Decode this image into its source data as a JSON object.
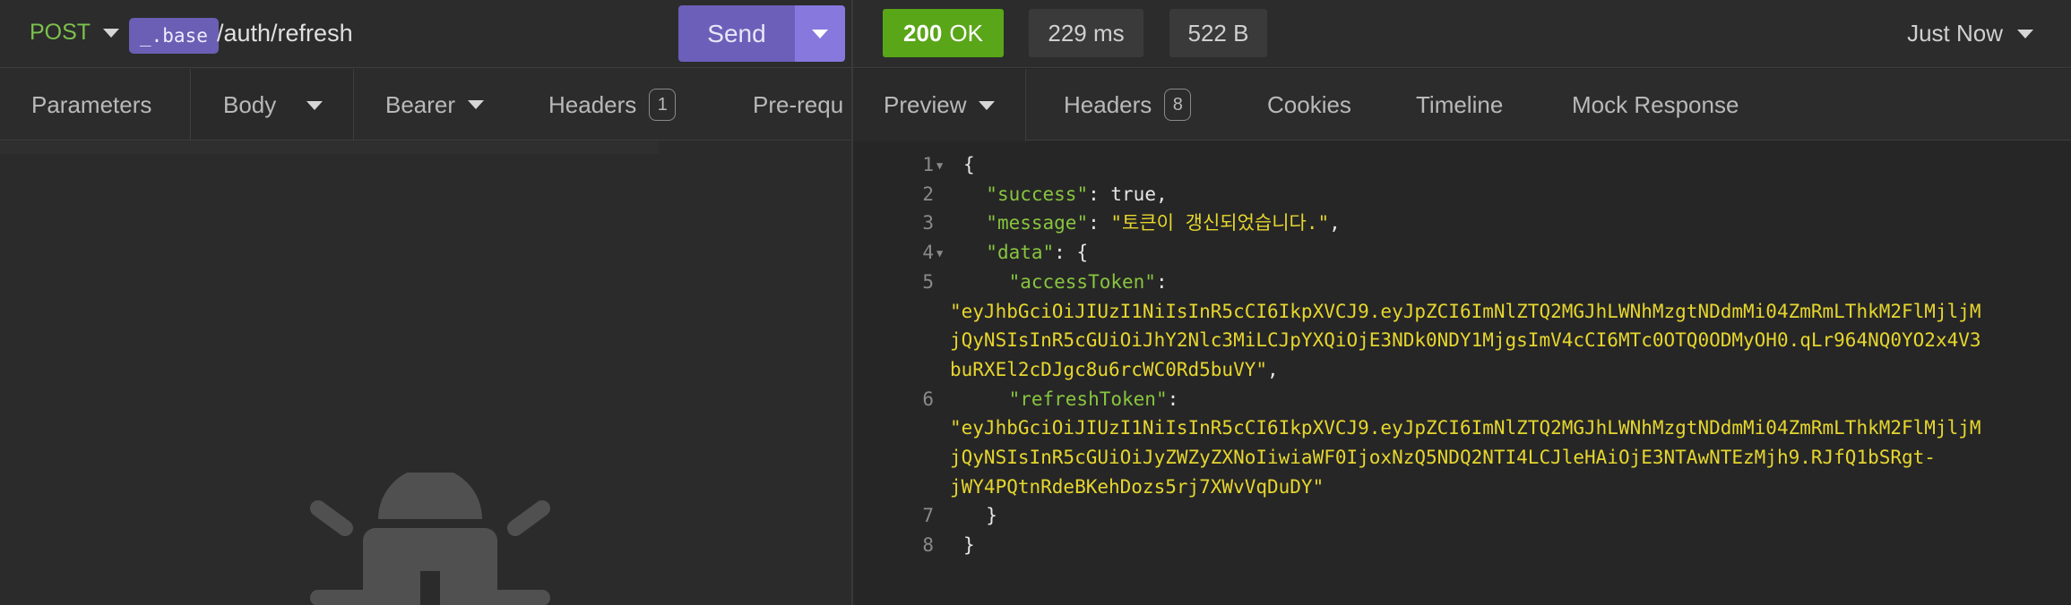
{
  "request": {
    "method": "POST",
    "base_tag": "_.base",
    "path": "/auth/refresh",
    "send_label": "Send",
    "tabs": [
      {
        "label": "Parameters"
      },
      {
        "label": "Body"
      },
      {
        "label": "Bearer"
      },
      {
        "label": "Headers",
        "count": "1"
      },
      {
        "label": "Pre-requ"
      }
    ]
  },
  "response": {
    "status_code": "200",
    "status_text": "OK",
    "time": "229 ms",
    "size": "522 B",
    "history_label": "Just Now",
    "tabs": [
      {
        "label": "Preview"
      },
      {
        "label": "Headers",
        "count": "8"
      },
      {
        "label": "Cookies"
      },
      {
        "label": "Timeline"
      },
      {
        "label": "Mock Response"
      }
    ],
    "line_numbers": [
      "1",
      "2",
      "3",
      "4",
      "5",
      "6",
      "7",
      "8"
    ],
    "body": {
      "l1": "{",
      "success_key": "\"success\"",
      "success_val": "true",
      "message_key": "\"message\"",
      "message_val": "\"토큰이 갱신되었습니다.\"",
      "data_key": "\"data\"",
      "access_key": "\"accessToken\"",
      "access_val_1": "\"eyJhbGciOiJIUzI1NiIsInR5cCI6IkpXVCJ9.eyJpZCI6ImNlZTQ2MGJhLWNhMzgtNDdmMi04ZmRmLThkM2FlMjljM",
      "access_val_2": "jQyNSIsInR5cGUiOiJhY2Nlc3MiLCJpYXQiOjE3NDk0NDY1MjgsImV4cCI6MTc0OTQ0ODMyOH0.qLr964NQ0YO2x4V3",
      "access_val_3": "buRXEl2cDJgc8u6rcWC0Rd5buVY\"",
      "refresh_key": "\"refreshToken\"",
      "refresh_val_1": "\"eyJhbGciOiJIUzI1NiIsInR5cCI6IkpXVCJ9.eyJpZCI6ImNlZTQ2MGJhLWNhMzgtNDdmMi04ZmRmLThkM2FlMjljM",
      "refresh_val_2": "jQyNSIsInR5cGUiOiJyZWZyZXNoIiwiaWF0IjoxNzQ5NDQ2NTI4LCJleHAiOjE3NTAwNTEzMjh9.RJfQ1bSRgt-",
      "refresh_val_3": "jWY4PQtnRdeBKehDozs5rj7XWvVqDuDY\"",
      "l7": "}",
      "l8": "}"
    }
  },
  "colors": {
    "accent_purple": "#6c5fba",
    "status_ok": "#59a619",
    "json_key": "#88c53f",
    "json_string": "#e6d62e"
  }
}
